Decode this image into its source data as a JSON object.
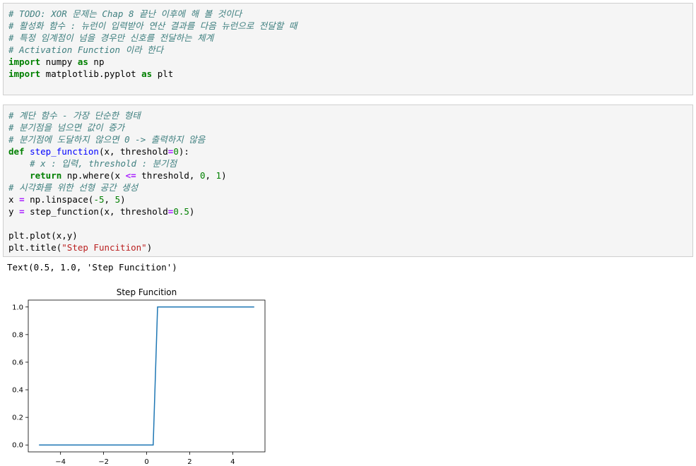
{
  "cells": [
    {
      "lines": [
        [
          {
            "t": "# TODO: XOR 문제는 Chap 8 끝난 이후에 해 볼 것이다",
            "c": "c"
          }
        ],
        [
          {
            "t": "# 활성화 함수 : 뉴런이 입력받아 연산 결과를 다음 뉴런으로 전달할 때",
            "c": "c"
          }
        ],
        [
          {
            "t": "# 특정 임계점이 넘을 경우만 신호를 전달하는 체계",
            "c": "c"
          }
        ],
        [
          {
            "t": "# Activation Function 이라 한다",
            "c": "c"
          }
        ],
        [
          {
            "t": "import",
            "c": "k"
          },
          {
            "t": " numpy ",
            "c": ""
          },
          {
            "t": "as",
            "c": "k"
          },
          {
            "t": " np",
            "c": ""
          }
        ],
        [
          {
            "t": "import",
            "c": "k"
          },
          {
            "t": " matplotlib.pyplot ",
            "c": ""
          },
          {
            "t": "as",
            "c": "k"
          },
          {
            "t": " plt",
            "c": ""
          }
        ]
      ]
    },
    {
      "lines": [
        [
          {
            "t": "# 계단 함수 - 가장 단순한 형태",
            "c": "c"
          }
        ],
        [
          {
            "t": "# 분기점을 넘으면 값이 증가",
            "c": "c"
          }
        ],
        [
          {
            "t": "# 분기점에 도달하지 않으면 0 -> 출력하지 않음",
            "c": "c"
          }
        ],
        [
          {
            "t": "def",
            "c": "k"
          },
          {
            "t": " ",
            "c": ""
          },
          {
            "t": "step_function",
            "c": "f"
          },
          {
            "t": "(x, threshold",
            "c": ""
          },
          {
            "t": "=",
            "c": "o"
          },
          {
            "t": "0",
            "c": "n"
          },
          {
            "t": "):",
            "c": ""
          }
        ],
        [
          {
            "t": "    ",
            "c": ""
          },
          {
            "t": "# x : 입력, threshold : 분기점",
            "c": "c"
          }
        ],
        [
          {
            "t": "    ",
            "c": ""
          },
          {
            "t": "return",
            "c": "k"
          },
          {
            "t": " np.where(x ",
            "c": ""
          },
          {
            "t": "<=",
            "c": "o"
          },
          {
            "t": " threshold, ",
            "c": ""
          },
          {
            "t": "0",
            "c": "n"
          },
          {
            "t": ", ",
            "c": ""
          },
          {
            "t": "1",
            "c": "n"
          },
          {
            "t": ")",
            "c": ""
          }
        ],
        [
          {
            "t": "# 시각화를 위한 선형 공간 생성",
            "c": "c"
          }
        ],
        [
          {
            "t": "x ",
            "c": ""
          },
          {
            "t": "=",
            "c": "o"
          },
          {
            "t": " np.linspace(",
            "c": ""
          },
          {
            "t": "-5",
            "c": "n"
          },
          {
            "t": ", ",
            "c": ""
          },
          {
            "t": "5",
            "c": "n"
          },
          {
            "t": ")",
            "c": ""
          }
        ],
        [
          {
            "t": "y ",
            "c": ""
          },
          {
            "t": "=",
            "c": "o"
          },
          {
            "t": " step_function(x, threshold",
            "c": ""
          },
          {
            "t": "=",
            "c": "o"
          },
          {
            "t": "0.5",
            "c": "n"
          },
          {
            "t": ")",
            "c": ""
          }
        ],
        [
          {
            "t": "",
            "c": ""
          }
        ],
        [
          {
            "t": "plt.plot(x,y)",
            "c": ""
          }
        ],
        [
          {
            "t": "plt.title(",
            "c": ""
          },
          {
            "t": "\"Step Funcition\"",
            "c": "s"
          },
          {
            "t": ")",
            "c": ""
          }
        ]
      ]
    }
  ],
  "output_text": "Text(0.5, 1.0, 'Step Funcition')",
  "chart_data": {
    "type": "line",
    "title": "Step Funcition",
    "xlabel": "",
    "ylabel": "",
    "xlim": [
      -5.5,
      5.5
    ],
    "ylim": [
      -0.05,
      1.05
    ],
    "xticks": [
      -4,
      -2,
      0,
      2,
      4
    ],
    "xtick_labels": [
      "−4",
      "−2",
      "0",
      "2",
      "4"
    ],
    "yticks": [
      0.0,
      0.2,
      0.4,
      0.6,
      0.8,
      1.0
    ],
    "ytick_labels": [
      "0.0",
      "0.2",
      "0.4",
      "0.6",
      "0.8",
      "1.0"
    ],
    "grid": false,
    "series": [
      {
        "color": "#1f77b4",
        "x": [
          -5,
          0.306,
          0.51,
          5
        ],
        "y": [
          0,
          0,
          1,
          1
        ]
      }
    ]
  }
}
